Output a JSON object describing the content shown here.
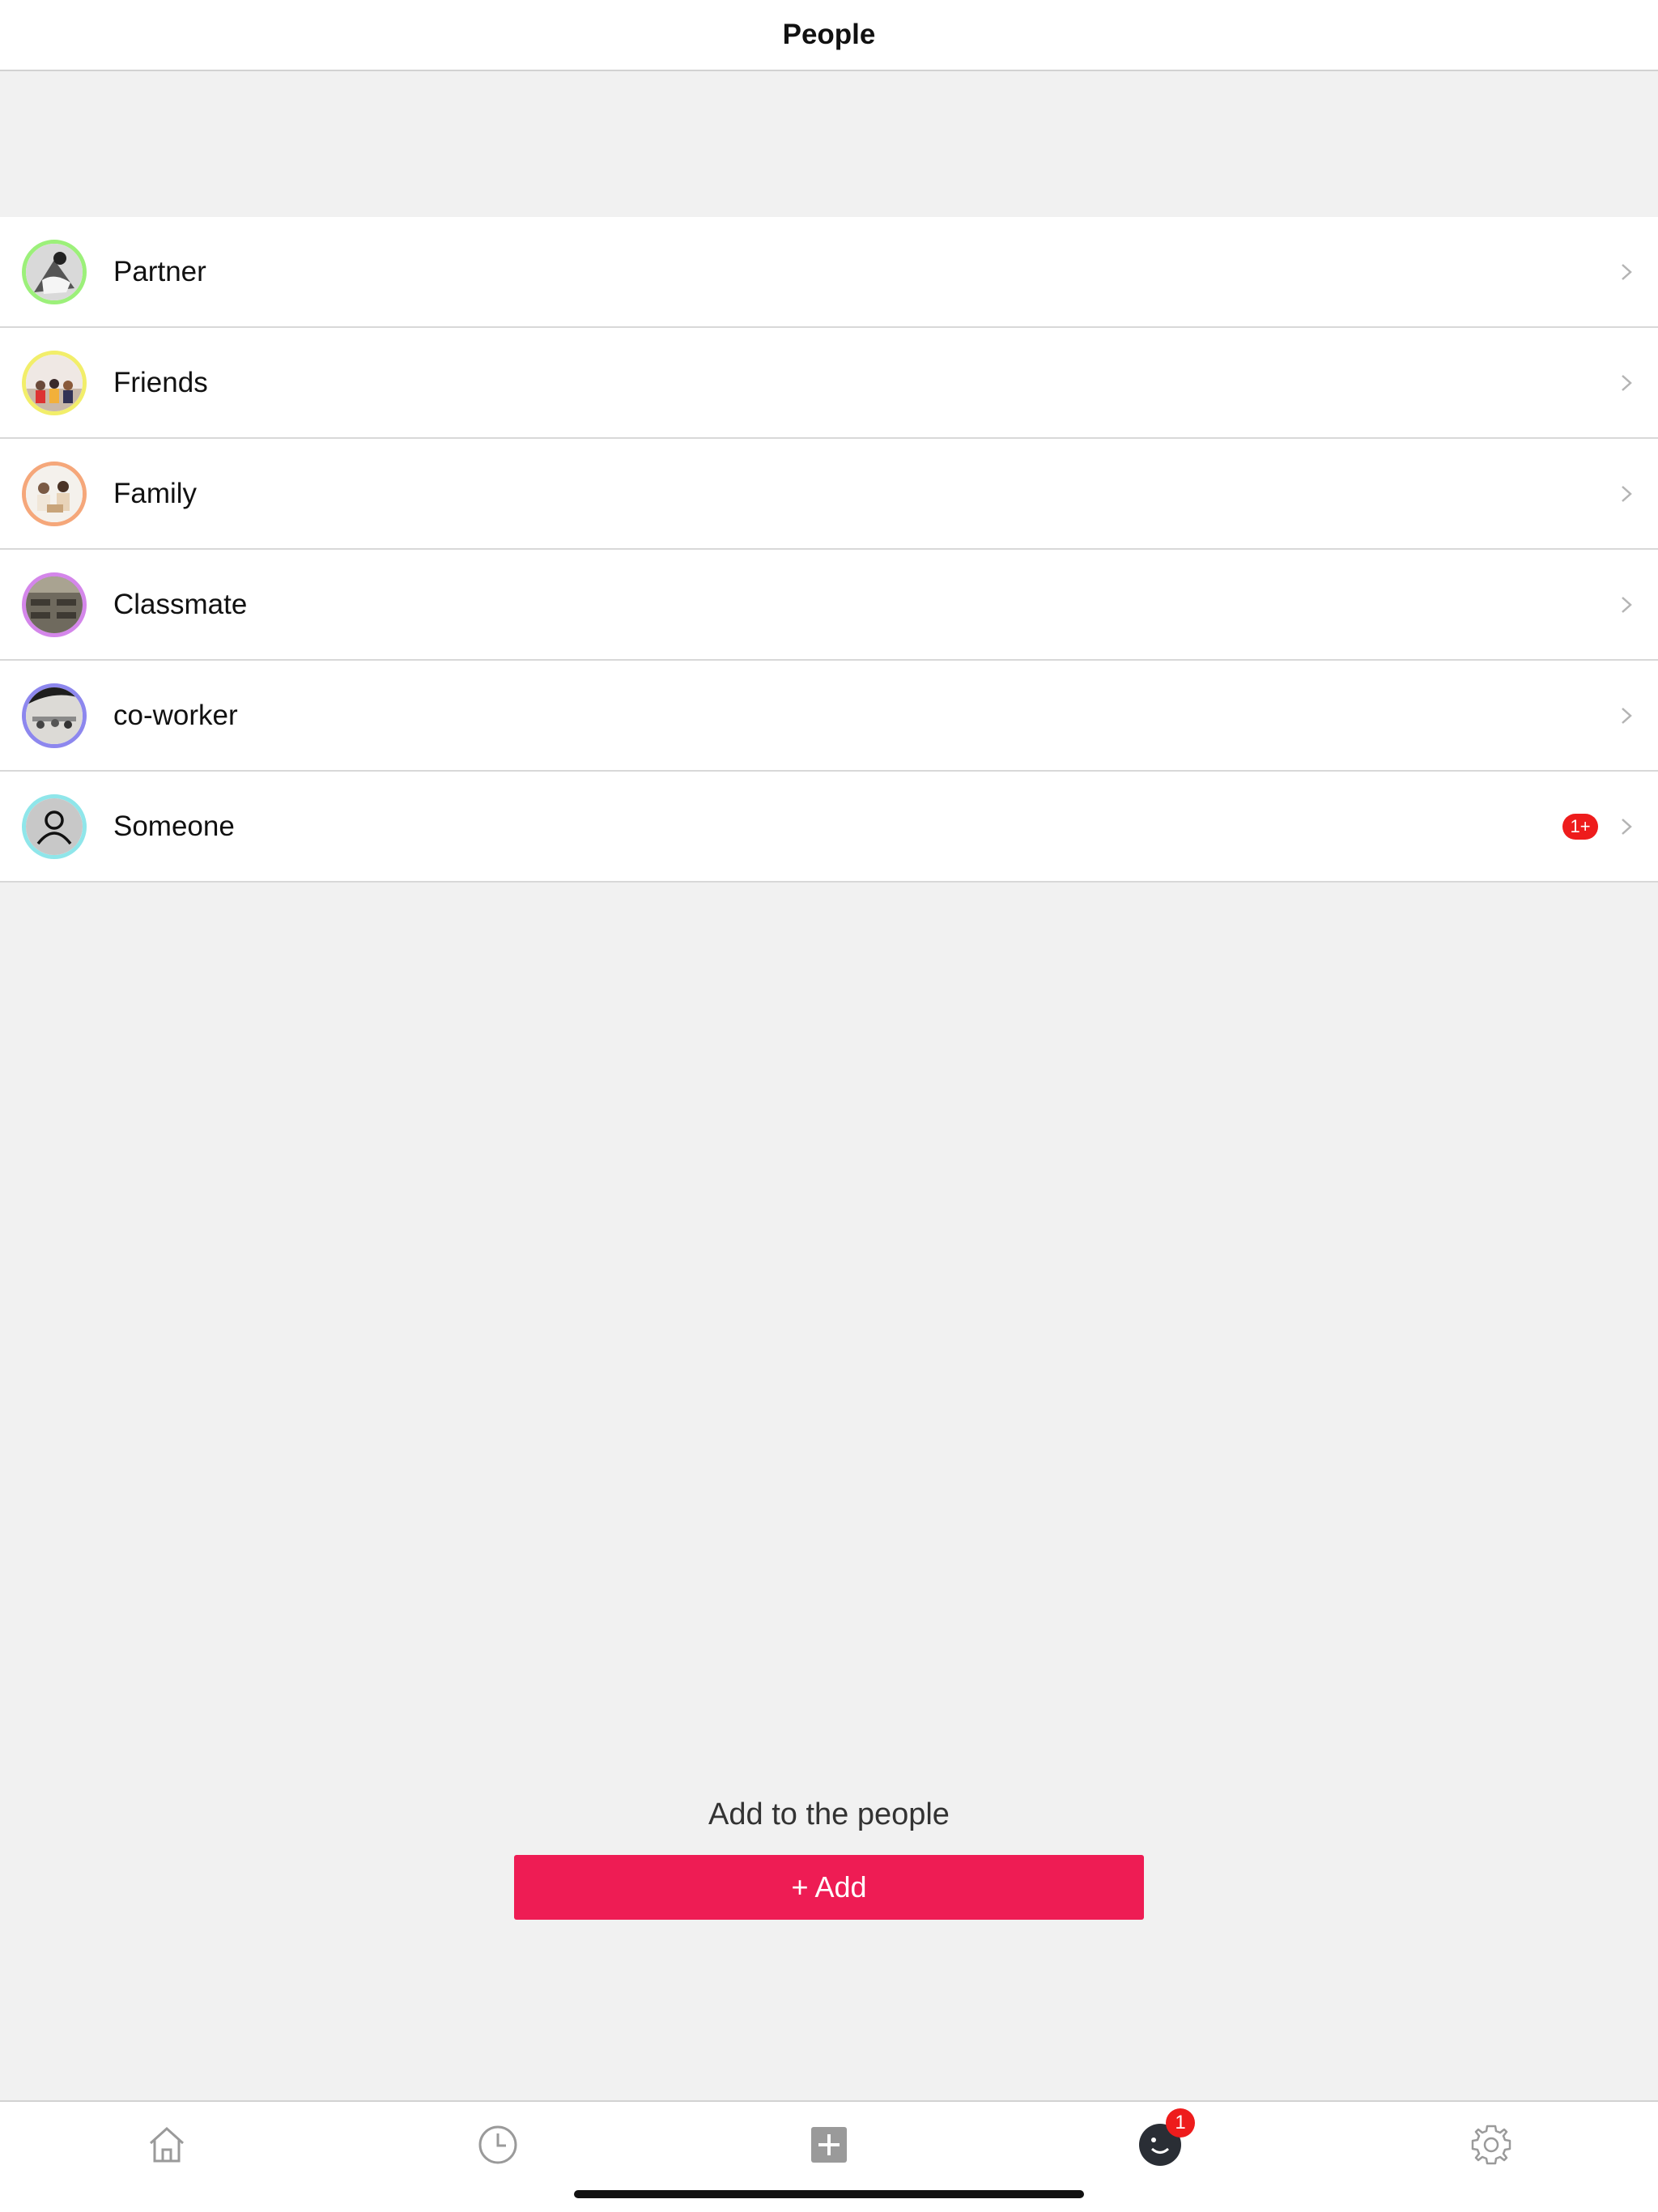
{
  "header": {
    "title": "People"
  },
  "groups": [
    {
      "label": "Partner",
      "ring_color": "#9cf07a",
      "icon": "partner-photo"
    },
    {
      "label": "Friends",
      "ring_color": "#f2ee6a",
      "icon": "friends-photo"
    },
    {
      "label": "Family",
      "ring_color": "#f5a77a",
      "icon": "family-photo"
    },
    {
      "label": "Classmate",
      "ring_color": "#d486ea",
      "icon": "classmate-photo"
    },
    {
      "label": "co-worker",
      "ring_color": "#8d87ee",
      "icon": "coworker-photo"
    },
    {
      "label": "Someone",
      "ring_color": "#8fe6ea",
      "icon": "person-icon",
      "badge": "1+"
    }
  ],
  "add_section": {
    "caption": "Add to the people",
    "button_label": "+ Add",
    "button_color": "#ee1c54"
  },
  "tab_bar": {
    "tabs": [
      {
        "icon": "home-icon"
      },
      {
        "icon": "clock-icon"
      },
      {
        "icon": "plus-square-icon"
      },
      {
        "icon": "smiley-icon",
        "badge": "1"
      },
      {
        "icon": "gear-icon"
      }
    ]
  }
}
